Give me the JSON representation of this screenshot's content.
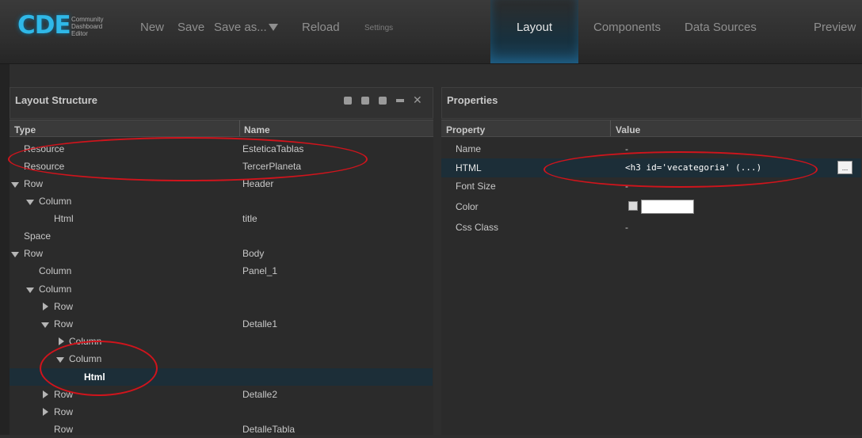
{
  "logo": {
    "mark": "CDE",
    "subtitle": "Community\nDashboard\nEditor"
  },
  "toolbar": {
    "new": "New",
    "save": "Save",
    "save_as": "Save as...",
    "reload": "Reload",
    "settings": "Settings"
  },
  "tabs": {
    "layout": "Layout",
    "components": "Components",
    "data_sources": "Data Sources",
    "preview": "Preview"
  },
  "layout_panel": {
    "title": "Layout Structure",
    "col_type": "Type",
    "col_name": "Name",
    "rows": [
      {
        "type": "Resource",
        "name": "EsteticaTablas"
      },
      {
        "type": "Resource",
        "name": "TercerPlaneta"
      },
      {
        "type": "Row",
        "name": "Header"
      },
      {
        "type": "Column",
        "name": ""
      },
      {
        "type": "Html",
        "name": "title"
      },
      {
        "type": "Space",
        "name": ""
      },
      {
        "type": "Row",
        "name": "Body"
      },
      {
        "type": "Column",
        "name": "Panel_1"
      },
      {
        "type": "Column",
        "name": ""
      },
      {
        "type": "Row",
        "name": ""
      },
      {
        "type": "Row",
        "name": "Detalle1"
      },
      {
        "type": "Column",
        "name": ""
      },
      {
        "type": "Column",
        "name": ""
      },
      {
        "type": "Html",
        "name": ""
      },
      {
        "type": "Row",
        "name": "Detalle2"
      },
      {
        "type": "Row",
        "name": ""
      },
      {
        "type": "Row",
        "name": "DetalleTabla"
      }
    ]
  },
  "properties_panel": {
    "title": "Properties",
    "col_property": "Property",
    "col_value": "Value",
    "rows": [
      {
        "property": "Name",
        "value": "-"
      },
      {
        "property": "HTML",
        "value": "<h3 id='vecategoria' (...)"
      },
      {
        "property": "Font Size",
        "value": "-"
      },
      {
        "property": "Color",
        "value": ""
      },
      {
        "property": "Css Class",
        "value": "-"
      }
    ],
    "edit_button": "..."
  },
  "colors": {
    "accent": "#2fb8e8",
    "annotation": "#d0141c",
    "selected_row": "#1c2e38"
  }
}
